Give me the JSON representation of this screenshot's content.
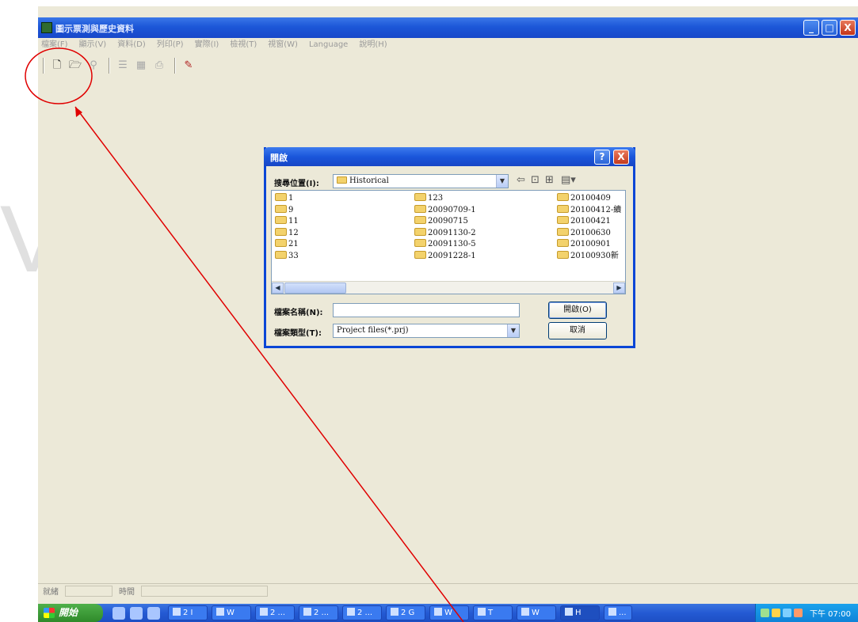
{
  "app": {
    "title": "圖示票測與歷史資料",
    "menu": [
      "檔案(F)",
      "顯示(V)",
      "資料(D)",
      "列印(P)",
      "實際(I)",
      "檢視(T)",
      "視窗(W)",
      "Language",
      "說明(H)"
    ],
    "window_buttons": {
      "minimize": "_",
      "maximize": "□",
      "close": "X"
    },
    "status_text": [
      "就緒",
      "時間"
    ]
  },
  "dialog": {
    "title": "開啟",
    "help_button": "?",
    "close_button": "X",
    "look_in_label": "搜尋位置(I):",
    "look_in_value": "Historical",
    "file_name_label": "檔案名稱(N):",
    "file_name_value": "",
    "file_type_label": "檔案類型(T):",
    "file_type_value": "Project files(*.prj)",
    "open_button": "開啟(O)",
    "cancel_button": "取消",
    "files": {
      "col1": [
        "1",
        "9",
        "11",
        "12",
        "21",
        "33"
      ],
      "col2": [
        "123",
        "20090709-1",
        "20090715",
        "20091130-2",
        "20091130-5",
        "20091228-1"
      ],
      "col3": [
        "20100409",
        "20100412-續",
        "20100421",
        "20100630",
        "20100901",
        "20100930新"
      ]
    }
  },
  "taskbar": {
    "start_label": "開始",
    "tasks": [
      "2 I",
      "W",
      "2 ...",
      "2 ...",
      "2 ...",
      "2 G",
      "W",
      "T",
      "W",
      "H",
      "..."
    ],
    "clock": "下午 07:00"
  },
  "colors": {
    "xp_blue": "#1c57d8",
    "annotation_red": "#e00000",
    "face": "#ece9d8"
  },
  "watermark": "V"
}
